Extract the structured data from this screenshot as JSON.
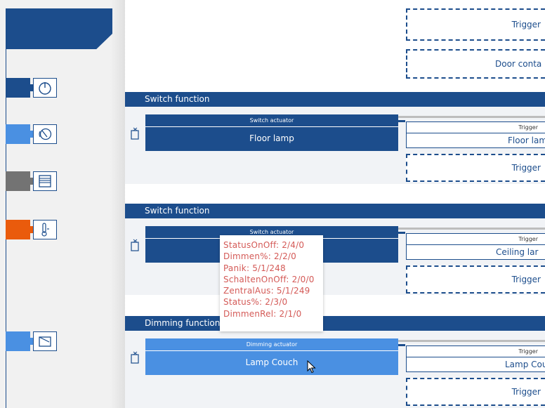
{
  "colors": {
    "brand_dark": "#1c4d8c",
    "brand_light": "#4a90e2",
    "category_gray": "#737373",
    "category_orange": "#ea5b0c",
    "tooltip_text": "#d45a57"
  },
  "sidebar": {
    "categories": [
      {
        "name": "power-icon",
        "color": "#1c4d8c"
      },
      {
        "name": "sensor-icon",
        "color": "#4a90e2"
      },
      {
        "name": "blinds-icon",
        "color": "#737373"
      },
      {
        "name": "thermostat-icon",
        "color": "#ea5b0c"
      },
      {
        "name": "dimmer-icon",
        "color": "#4a90e2"
      }
    ]
  },
  "canvas": {
    "top_triggers": [
      "Trigger",
      "Door conta"
    ],
    "sections": [
      {
        "title": "Switch function",
        "actuator_label": "Switch actuator",
        "actuator_name": "Floor lamp",
        "trigger_header": "Trigger",
        "trigger_name": "Floor lam",
        "extra_trigger": "Trigger"
      },
      {
        "title": "Switch function",
        "actuator_label": "Switch actuator",
        "actuator_name": "",
        "trigger_header": "Trigger",
        "trigger_name": "Ceiling lar",
        "extra_trigger": "Trigger"
      },
      {
        "title": "Dimming function",
        "actuator_label": "Dimming actuator",
        "actuator_name": "Lamp Couch",
        "trigger_header": "Trigger",
        "trigger_name": "Lamp Cou",
        "extra_trigger": "Trigger"
      }
    ]
  },
  "tooltip": {
    "lines": [
      "StatusOnOff: 2/4/0",
      "Dimmen%: 2/2/0",
      "Panik: 5/1/248",
      "SchaltenOnOff: 2/0/0",
      "ZentralAus: 5/1/249",
      "Status%: 2/3/0",
      "DimmenRel: 2/1/0"
    ]
  }
}
